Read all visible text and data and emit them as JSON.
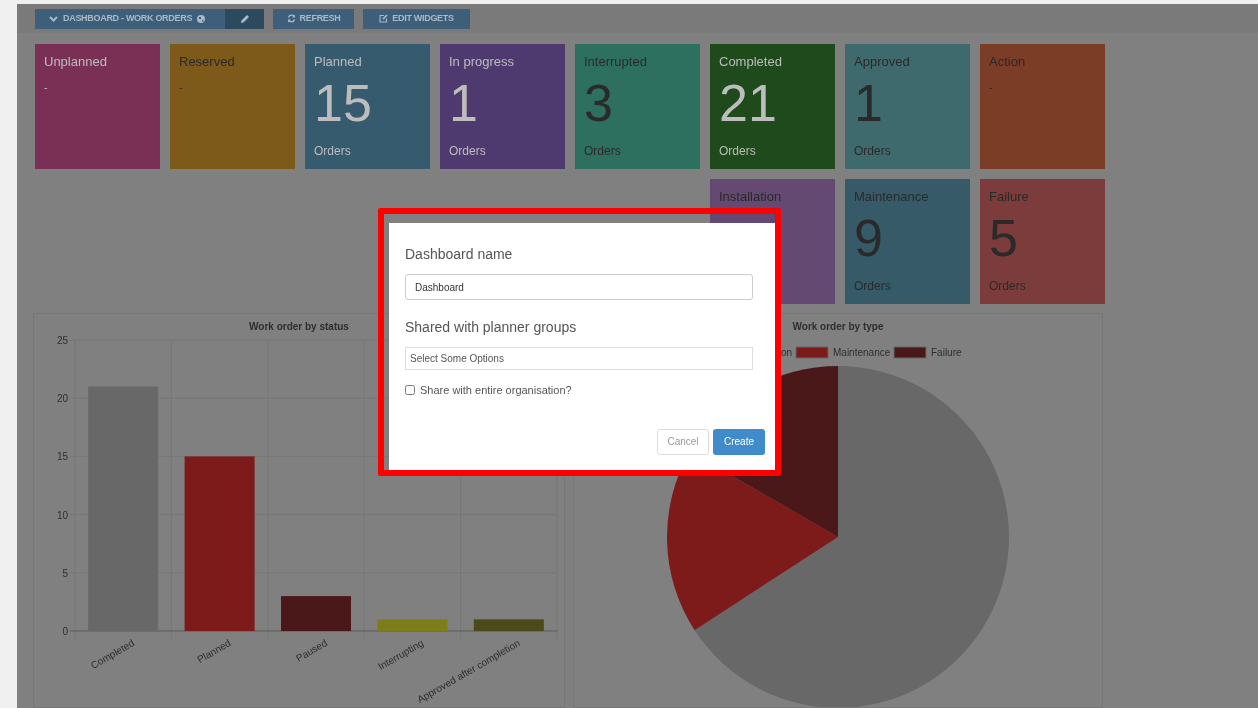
{
  "toolbar": {
    "dashboard_button": {
      "label": "DASHBOARD - WORK ORDERS"
    },
    "buttons": [
      {
        "kind": "edit"
      },
      {
        "kind": "refresh",
        "label": "REFRESH"
      },
      {
        "kind": "edit-widgets",
        "label": "EDIT WIDGETS"
      }
    ]
  },
  "tiles": [
    {
      "label": "Unplanned",
      "value": "-",
      "color": "#7a3055",
      "bright_text": true
    },
    {
      "label": "Reserved",
      "value": "-",
      "color": "#7d5a1a",
      "bright_text": false
    },
    {
      "label": "Planned",
      "value": "15",
      "unit": "Orders",
      "color": "#365a6e",
      "bright_text": true
    },
    {
      "label": "In progress",
      "value": "1",
      "unit": "Orders",
      "color": "#4e3a6e",
      "bright_text": true
    },
    {
      "label": "Interrupted",
      "value": "3",
      "unit": "Orders",
      "color": "#2e7060",
      "bright_text": false
    },
    {
      "label": "Completed",
      "value": "21",
      "unit": "Orders",
      "color": "#1e4a1c",
      "bright_text": true
    },
    {
      "label": "Approved",
      "value": "1",
      "unit": "Orders",
      "color": "#3e6a6e",
      "bright_text": false
    },
    {
      "label": "Action",
      "value": "-",
      "color": "#7c3d26",
      "bright_text": false
    },
    {
      "label": "Installation",
      "color": "#644a72",
      "bright_text": false
    },
    {
      "label": "Maintenance",
      "value": "9",
      "unit": "Orders",
      "color": "#365a68",
      "bright_text": false
    },
    {
      "label": "Failure",
      "value": "5",
      "unit": "Orders",
      "color": "#7c3c3c",
      "bright_text": false
    }
  ],
  "status_chart": {
    "chart_data": {
      "type": "bar",
      "title": "Work order by status",
      "categories": [
        "Completed",
        "Planned",
        "Paused",
        "Interrupting",
        "Approved after completion"
      ],
      "series": [
        {
          "color": "#686868",
          "values": [
            21,
            null,
            null,
            null,
            null
          ]
        },
        {
          "color": "#7d1a1a",
          "values": [
            null,
            15,
            null,
            null,
            null
          ]
        },
        {
          "color": "#4a1818",
          "values": [
            null,
            null,
            3,
            null,
            null
          ]
        },
        {
          "color": "#7d7d1a",
          "values": [
            null,
            null,
            null,
            1,
            null
          ]
        },
        {
          "color": "#4a4a1a",
          "values": [
            null,
            null,
            null,
            null,
            1
          ]
        }
      ],
      "grid": true,
      "ylim": [
        0,
        25
      ],
      "yticks": [
        0,
        5,
        10,
        15,
        20,
        25
      ]
    }
  },
  "type_chart": {
    "title": "Work order by type",
    "legend": [
      {
        "label": "on"
      },
      {
        "label": "Maintenance",
        "color": "#7d1a1a"
      },
      {
        "label": "Failure",
        "color": "#4a1818"
      }
    ]
  },
  "dialog": {
    "name_label": "Dashboard name",
    "name_value": "Dashboard",
    "groups_label": "Shared with planner groups",
    "groups_placeholder": "Select Some Options",
    "share_label": "Share with entire organisation?",
    "share_checked": false,
    "buttons": [
      {
        "kind": "secondary",
        "label": "Cancel"
      },
      {
        "kind": "primary",
        "label": "Create"
      }
    ]
  }
}
